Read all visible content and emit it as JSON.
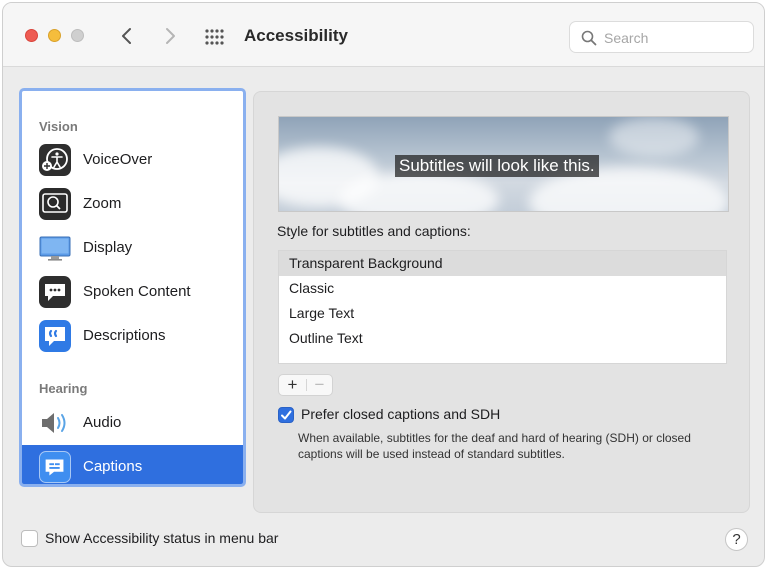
{
  "window": {
    "title": "Accessibility"
  },
  "search": {
    "placeholder": "Search",
    "value": ""
  },
  "sidebar": {
    "sections": [
      {
        "label": "Vision",
        "items": [
          {
            "label": "VoiceOver",
            "icon": "voiceover-icon"
          },
          {
            "label": "Zoom",
            "icon": "zoom-icon"
          },
          {
            "label": "Display",
            "icon": "display-icon"
          },
          {
            "label": "Spoken Content",
            "icon": "spoken-content-icon"
          },
          {
            "label": "Descriptions",
            "icon": "descriptions-icon"
          }
        ]
      },
      {
        "label": "Hearing",
        "items": [
          {
            "label": "Audio",
            "icon": "audio-icon"
          },
          {
            "label": "Captions",
            "icon": "captions-icon",
            "selected": true
          }
        ]
      }
    ]
  },
  "captions": {
    "preview_text": "Subtitles will look like this.",
    "style_label": "Style for subtitles and captions:",
    "styles": [
      "Transparent Background",
      "Classic",
      "Large Text",
      "Outline Text"
    ],
    "selected_style": "Transparent Background",
    "add_label": "+",
    "remove_label": "−",
    "sdh": {
      "checked": true,
      "label": "Prefer closed captions and SDH",
      "description": "When available, subtitles for the deaf and hard of hearing (SDH) or closed captions will be used instead of standard subtitles."
    }
  },
  "footer": {
    "status_label": "Show Accessibility status in menu bar",
    "status_checked": false,
    "help_label": "?"
  },
  "colors": {
    "accent": "#2f6fdf",
    "close": "#ee5b52",
    "minimize": "#f5bd3c",
    "maximize_disabled": "#cfcfcf"
  }
}
